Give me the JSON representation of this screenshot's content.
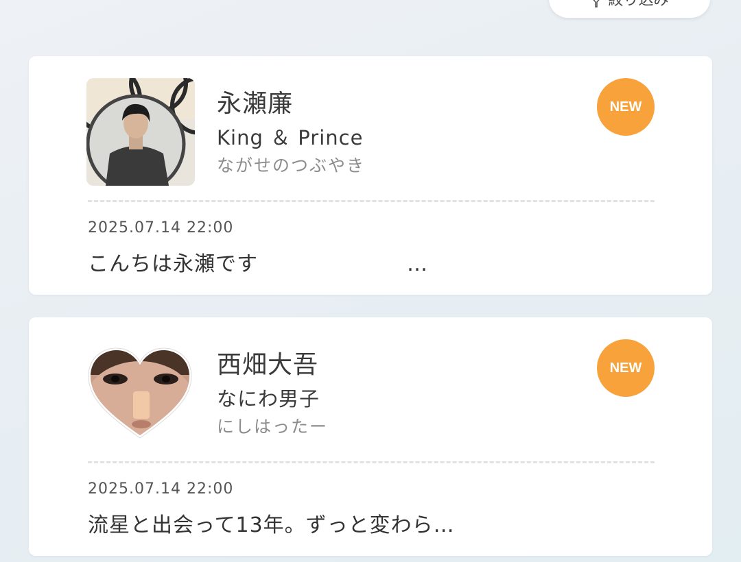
{
  "filter": {
    "label": "絞り込み",
    "icon": "filter-icon"
  },
  "colors": {
    "badge": "#f7a23b",
    "card_bg": "#ffffff",
    "page_bg": "#e8eef3"
  },
  "posts": [
    {
      "name": "永瀬廉",
      "group": "King ＆ Prince",
      "title": "ながせのつぶやき",
      "badge": "NEW",
      "date": "2025.07.14 22:00",
      "message": "こんちは永瀬です　　　　　　　…",
      "avatar_shape": "square"
    },
    {
      "name": "西畑大吾",
      "group": "なにわ男子",
      "title": "にしはったー",
      "badge": "NEW",
      "date": "2025.07.14 22:00",
      "message": "流星と出会って13年。ずっと変わら…",
      "avatar_shape": "heart"
    }
  ]
}
